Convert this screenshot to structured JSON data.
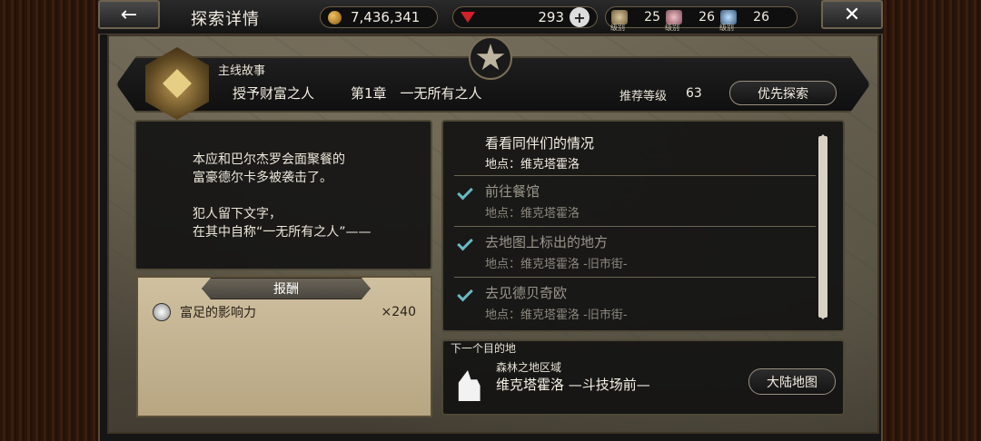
{
  "topbar": {
    "back_icon": "←",
    "close_icon": "✕",
    "title": "探索详情",
    "gold": "7,436,341",
    "gems": "293",
    "plus_icon": "+",
    "levels": [
      {
        "label": "级别",
        "value": "25",
        "icon": "helmet-icon"
      },
      {
        "label": "级别",
        "value": "26",
        "icon": "flower-icon"
      },
      {
        "label": "级别",
        "value": "26",
        "icon": "crystal-icon"
      }
    ]
  },
  "story": {
    "category": "主线故事",
    "name": "授予财富之人",
    "chapter": "第1章　一无所有之人",
    "recommend_label": "推荐等级",
    "recommend_level": "63",
    "priority_button": "优先探索"
  },
  "description": {
    "lines": [
      "本应和巴尔杰罗会面聚餐的",
      "富豪德尔卡多被袭击了。"
    ],
    "lines2": [
      "犯人留下文字，",
      "在其中自称“一无所有之人”——"
    ]
  },
  "reward": {
    "title": "报酬",
    "items": [
      {
        "name": "富足的影响力",
        "qty": "×240",
        "icon": "influence-icon"
      }
    ]
  },
  "objectives": {
    "current": {
      "title": "看看同伴们的情况",
      "location": "地点：维克塔霍洛"
    },
    "done": [
      {
        "title": "前往餐馆",
        "location": "地点：维克塔霍洛"
      },
      {
        "title": "去地图上标出的地方",
        "location": "地点：维克塔霍洛 -旧市街-"
      },
      {
        "title": "去见德贝奇欧",
        "location": "地点：维克塔霍洛 -旧市街-"
      }
    ]
  },
  "next": {
    "label": "下一个目的地",
    "area": "森林之地区域",
    "destination": "维克塔霍洛 —斗技场前—",
    "map_button": "大陆地图"
  },
  "colors": {
    "check": "#69b9c2",
    "reward_bg": "#c9b995",
    "panel_bg": "#121212"
  }
}
